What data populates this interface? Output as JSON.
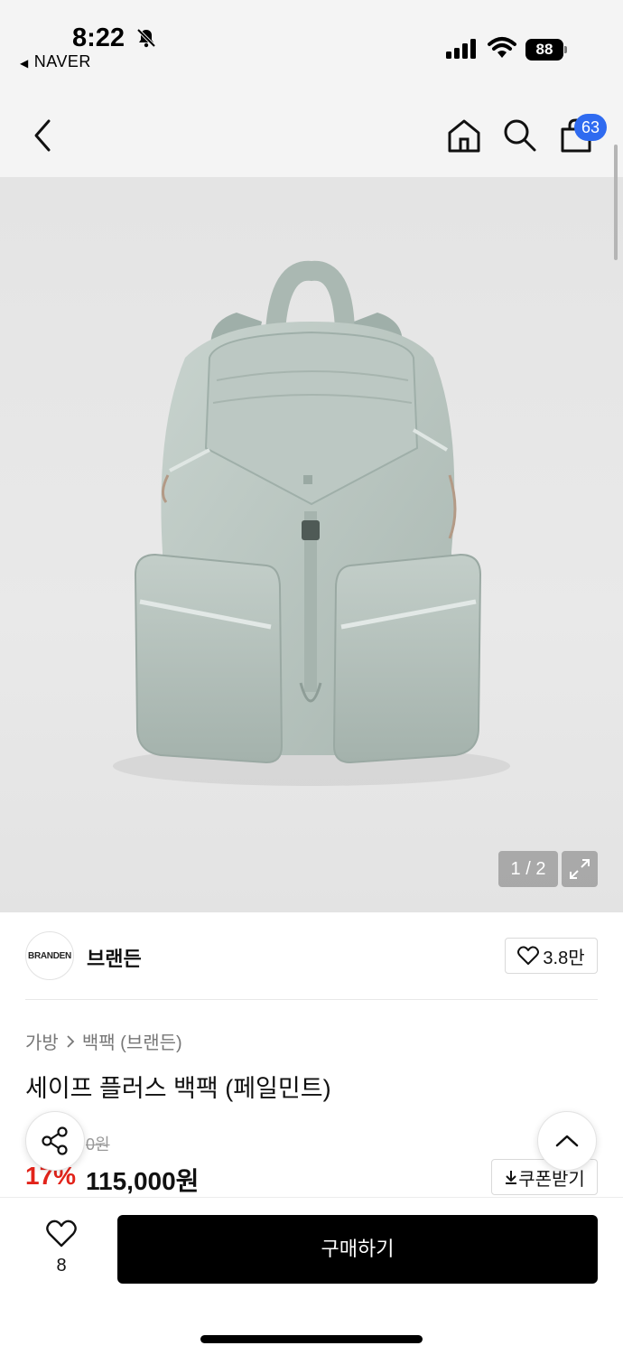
{
  "status_bar": {
    "time": "8:22",
    "back_app": "NAVER",
    "battery": "88"
  },
  "nav": {
    "cart_count": "63"
  },
  "gallery": {
    "counter": "1 / 2",
    "product_color": "#b9c6c1"
  },
  "brand": {
    "logo_text": "BRANDEN",
    "name": "브랜든",
    "like_count": "3.8만"
  },
  "product": {
    "breadcrumb": [
      "가방",
      "백팩 (브랜든)"
    ],
    "title": "세이프 플러스 백팩 (페일민트)",
    "original_price_partial": "0원",
    "discount_partial": "17%",
    "sale_price": "115,000원",
    "coupon_label": "쿠폰받기"
  },
  "bottom_bar": {
    "wish_count": "8",
    "buy_label": "구매하기"
  },
  "colors": {
    "accent_red": "#e2231a",
    "badge_blue": "#2f6bf0",
    "buy_button": "#000000"
  }
}
